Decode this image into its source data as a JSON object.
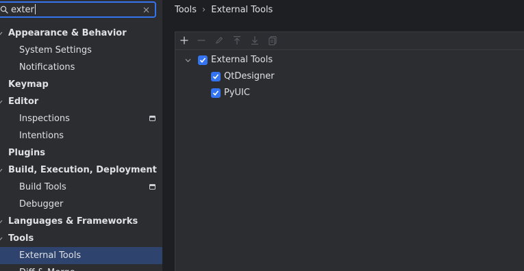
{
  "search": {
    "value": "exter"
  },
  "sidebar": {
    "items": [
      {
        "label": "Appearance & Behavior",
        "level": 0,
        "expanded": true
      },
      {
        "label": "System Settings",
        "level": 1
      },
      {
        "label": "Notifications",
        "level": 1
      },
      {
        "label": "Keymap",
        "level": 0
      },
      {
        "label": "Editor",
        "level": 0,
        "expanded": true
      },
      {
        "label": "Inspections",
        "level": 1,
        "badge": true
      },
      {
        "label": "Intentions",
        "level": 1
      },
      {
        "label": "Plugins",
        "level": 0
      },
      {
        "label": "Build, Execution, Deployment",
        "level": 0,
        "expanded": true
      },
      {
        "label": "Build Tools",
        "level": 1,
        "badge": true
      },
      {
        "label": "Debugger",
        "level": 1
      },
      {
        "label": "Languages & Frameworks",
        "level": 0,
        "expanded": true
      },
      {
        "label": "Tools",
        "level": 0,
        "expanded": true
      },
      {
        "label": "External Tools",
        "level": 1,
        "selected": true
      },
      {
        "label": "Diff & Merge",
        "level": 1
      }
    ]
  },
  "breadcrumb": {
    "parent": "Tools",
    "separator": "›",
    "current": "External Tools"
  },
  "toolbar": {
    "buttons": [
      "add-icon",
      "remove-icon",
      "edit-icon",
      "move-up-icon",
      "move-down-icon",
      "copy-icon"
    ]
  },
  "tools_tree": {
    "group": {
      "label": "External Tools",
      "checked": true,
      "expanded": true
    },
    "items": [
      {
        "label": "QtDesigner",
        "checked": true
      },
      {
        "label": "PyUIC",
        "checked": true
      }
    ]
  },
  "colors": {
    "accent": "#3574f0",
    "selection": "#2e436e",
    "sidebar_bg": "#2b2d30",
    "main_bg": "#1e1f22",
    "text": "#dfe1e5"
  }
}
